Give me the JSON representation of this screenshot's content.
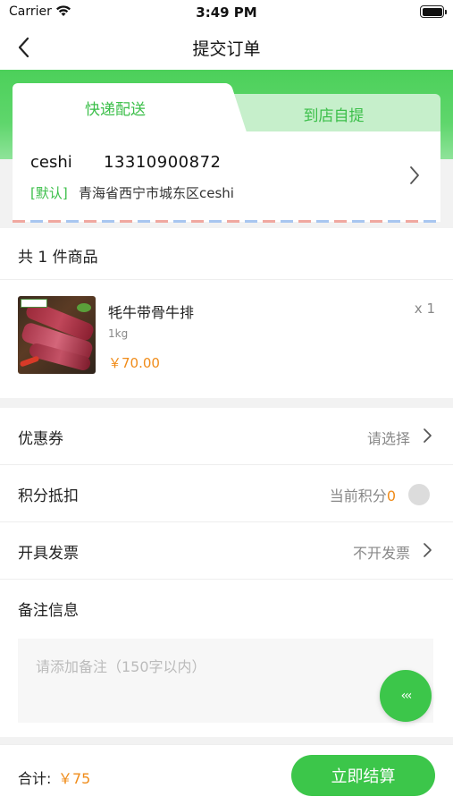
{
  "status_bar": {
    "carrier": "Carrier",
    "time": "3:49 PM"
  },
  "nav": {
    "title": "提交订单",
    "back_icon": "chevron-left-icon"
  },
  "delivery_tabs": [
    {
      "label": "快递配送",
      "active": true
    },
    {
      "label": "到店自提",
      "active": false
    }
  ],
  "address": {
    "name": "ceshi",
    "phone": "13310900872",
    "default_tag": "[默认]",
    "detail": "青海省西宁市城东区ceshi"
  },
  "goods": {
    "count_label": "共 1 件商品",
    "items": [
      {
        "name": "牦牛带骨牛排",
        "spec": "1kg",
        "price": "￥70.00",
        "qty": "x 1"
      }
    ]
  },
  "options": {
    "coupon": {
      "label": "优惠券",
      "value": "请选择"
    },
    "points": {
      "label": "积分抵扣",
      "prefix": "当前积分",
      "value": "0"
    },
    "invoice": {
      "label": "开具发票",
      "value": "不开发票"
    },
    "remark": {
      "label": "备注信息",
      "placeholder": "请添加备注（150字以内）"
    }
  },
  "float_button": {
    "label": "‹‹‹"
  },
  "footer": {
    "total_label": "合计:",
    "total_amount": "￥75",
    "checkout_label": "立即结算"
  },
  "colors": {
    "accent": "#3cc64a",
    "price": "#f08c1a"
  }
}
